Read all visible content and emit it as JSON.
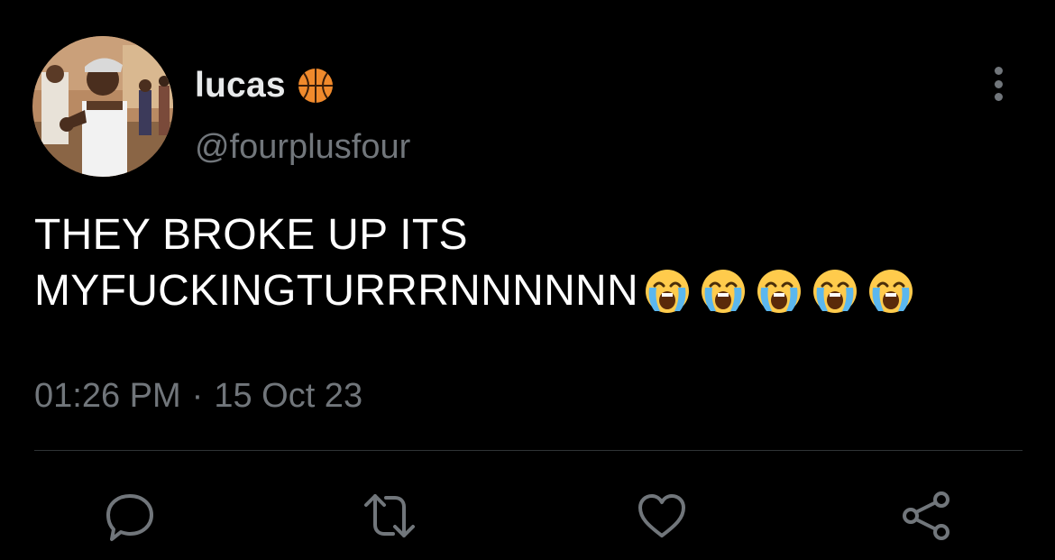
{
  "author": {
    "display_name": "lucas",
    "badge_icon": "basketball-icon",
    "handle": "@fourplusfour"
  },
  "tweet": {
    "text_line_1": "THEY BROKE UP ITS",
    "text_line_2": "MYFUCKINGTURRRNNNNNN",
    "emoji_icon": "loudly-crying-face-icon",
    "emoji_count": 5,
    "time": "01:26 PM",
    "separator": "·",
    "date": "15 Oct 23"
  },
  "actions": [
    "reply-icon",
    "retweet-icon",
    "like-icon",
    "share-icon"
  ],
  "colors": {
    "background": "#000000",
    "primary_text": "#e7e9ea",
    "secondary_text": "#71767b",
    "divider": "#2f3336"
  }
}
